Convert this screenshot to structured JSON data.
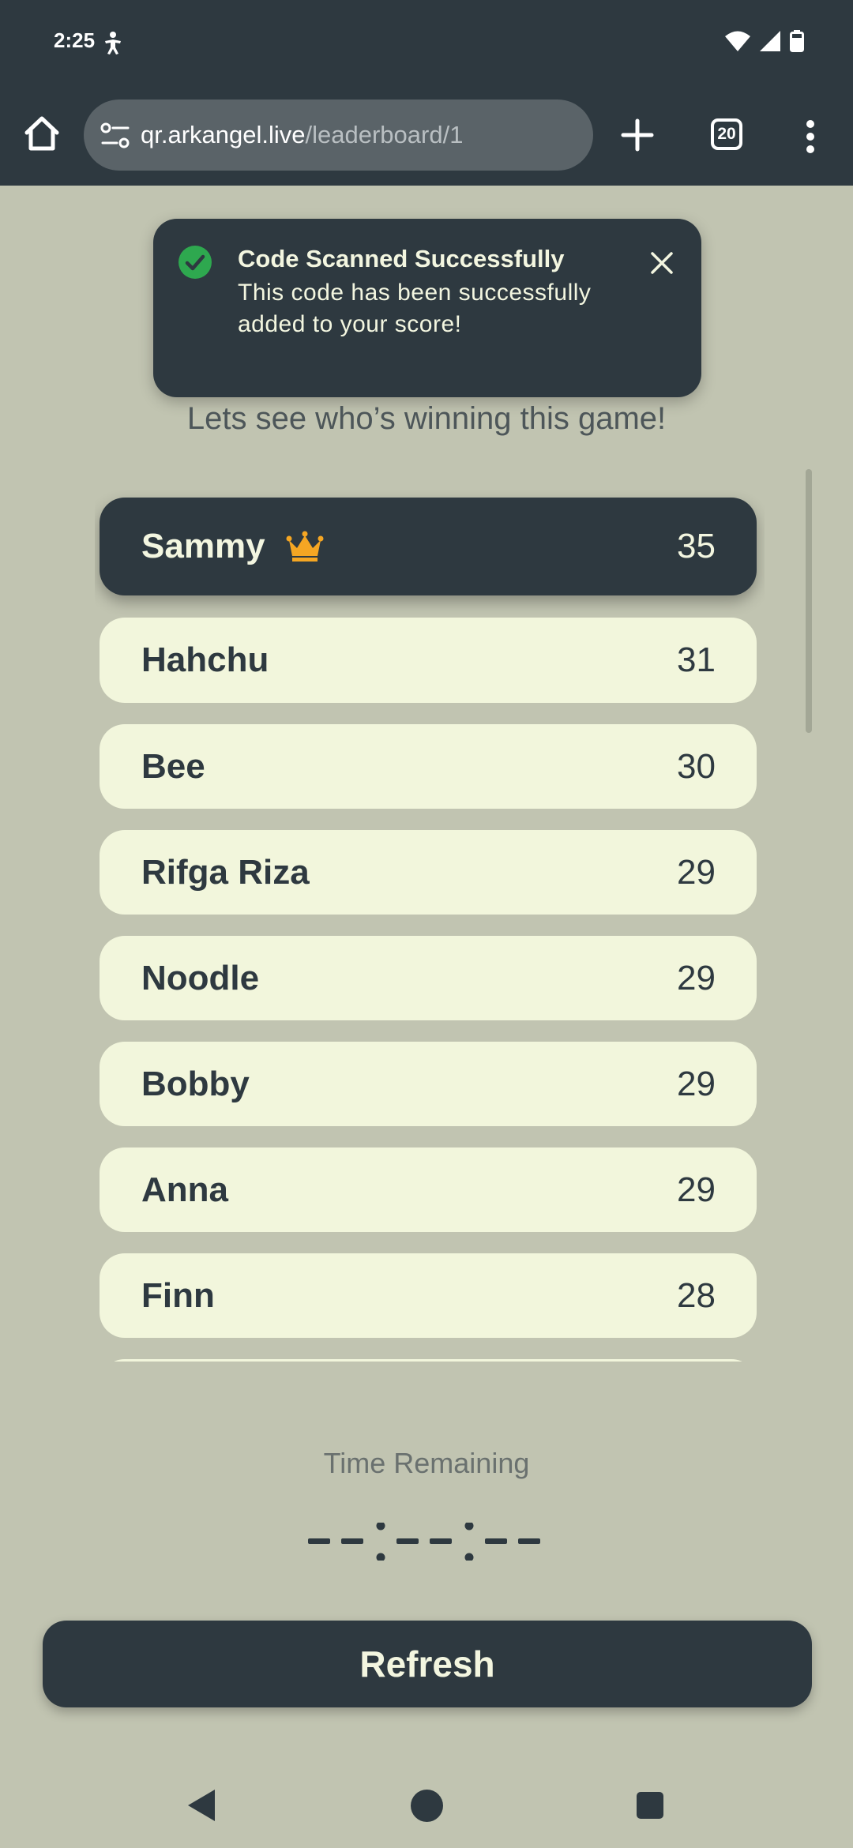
{
  "status_bar": {
    "time": "2:25",
    "icons": [
      "accessibility-icon",
      "wifi-icon",
      "cell-signal-icon",
      "battery-icon"
    ]
  },
  "browser": {
    "url_domain": "qr.arkangel.live",
    "url_path": "/leaderboard/1",
    "tab_count": "20"
  },
  "toast": {
    "title": "Code Scanned Successfully",
    "message": "This code has been successfully added to your score!"
  },
  "page": {
    "subtitle": "Lets see who’s winning this game!"
  },
  "leaderboard": [
    {
      "name": "Sammy",
      "score": "35",
      "leader": true
    },
    {
      "name": "Hahchu",
      "score": "31"
    },
    {
      "name": "Bee",
      "score": "30"
    },
    {
      "name": "Rifga Riza",
      "score": "29"
    },
    {
      "name": "Noodle",
      "score": "29"
    },
    {
      "name": "Bobby",
      "score": "29"
    },
    {
      "name": "Anna",
      "score": "29"
    },
    {
      "name": "Finn",
      "score": "28"
    }
  ],
  "timer": {
    "label": "Time Remaining",
    "value": "--:--:--"
  },
  "actions": {
    "refresh_label": "Refresh"
  },
  "colors": {
    "background": "#c1c4b1",
    "dark": "#2e3940",
    "row": "#f2f6dc",
    "crown": "#f5a623",
    "success": "#2ea84f"
  }
}
